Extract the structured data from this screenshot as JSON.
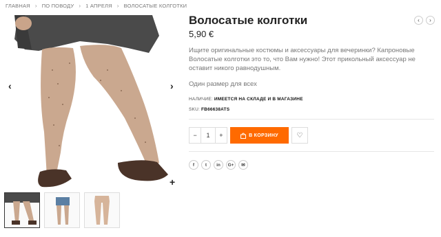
{
  "breadcrumb": [
    "ГЛАВНАЯ",
    "ПО ПОВОДУ",
    "1 АПРЕЛЯ",
    "ВОЛОСАТЫЕ КОЛГОТКИ"
  ],
  "product": {
    "title": "Волосатые колготки",
    "price": "5,90 €",
    "description": "Ищите оригинальные костюмы и аксессуары для вечеринки?  Капроновые Волосатые колготки это то, что Вам нужно! Этот прикольный аксессуар не оставит никого равнодушным.",
    "size": "Один размер для всех",
    "availability_label": "НАЛИЧИЕ:",
    "availability_value": "ИМЕЕТСЯ НА СКЛАДЕ И В МАГАЗИНЕ",
    "sku_label": "SKU:",
    "sku_value": "FB66638ATS"
  },
  "cart": {
    "minus": "−",
    "quantity": "1",
    "plus": "+",
    "add_label": "В КОРЗИНУ"
  },
  "gallery": {
    "prev": "‹",
    "next": "›",
    "zoom": "+"
  },
  "pager": {
    "prev": "‹",
    "next": "›"
  },
  "share": [
    "f",
    "t",
    "in",
    "G+",
    "✉"
  ],
  "colors": {
    "accent": "#ff6a00"
  }
}
